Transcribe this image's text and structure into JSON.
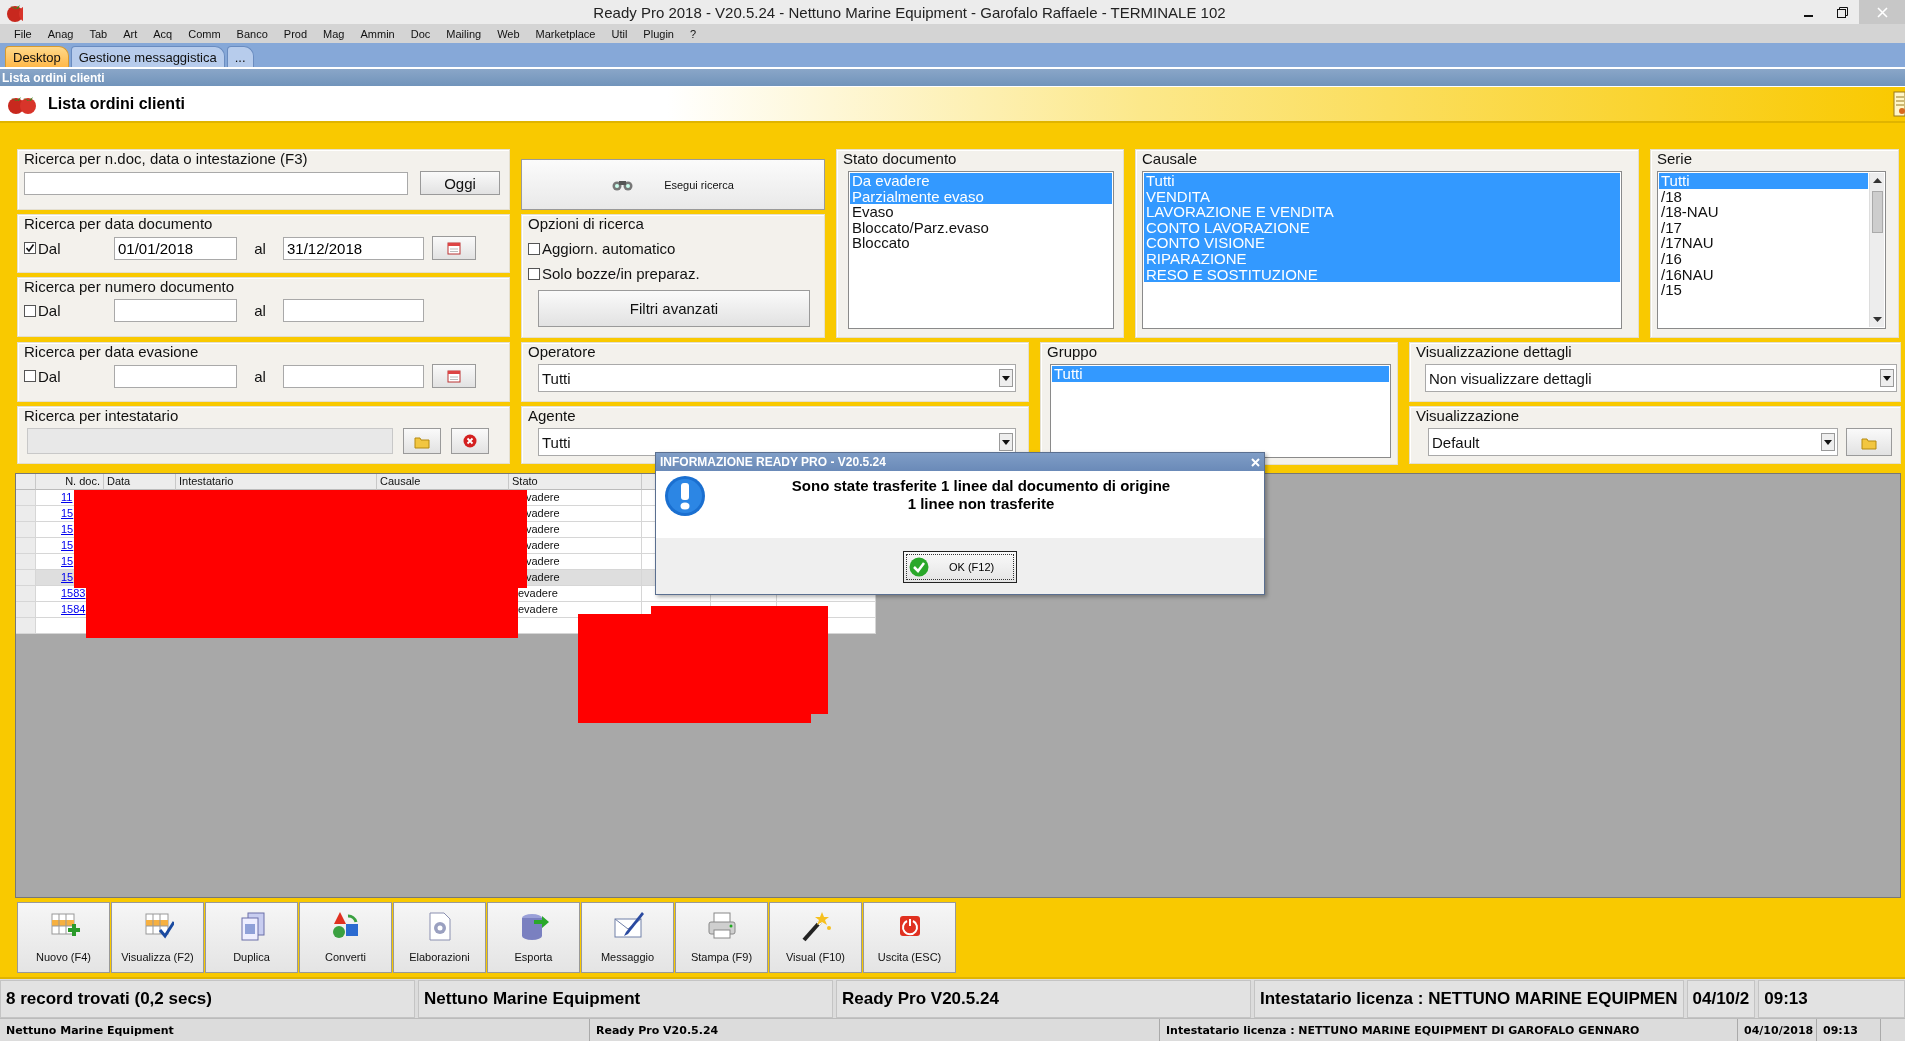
{
  "window": {
    "title": "Ready Pro 2018 - V20.5.24 - Nettuno Marine Equipment - Garofalo Raffaele - TERMINALE 102"
  },
  "menu": [
    "File",
    "Anag",
    "Tab",
    "Art",
    "Acq",
    "Comm",
    "Banco",
    "Prod",
    "Mag",
    "Ammin",
    "Doc",
    "Mailing",
    "Web",
    "Marketplace",
    "Util",
    "Plugin",
    "?"
  ],
  "tabs": [
    {
      "label": "Desktop",
      "selected": true
    },
    {
      "label": "Gestione messaggistica",
      "selected": false
    },
    {
      "label": "...",
      "selected": false
    }
  ],
  "caption": "Lista ordini clienti",
  "header": {
    "title": "Lista ordini clienti"
  },
  "filters": {
    "search": {
      "label": "Ricerca per n.doc, data o intestazione (F3)",
      "button": "Oggi"
    },
    "doc_date": {
      "label": "Ricerca per data documento",
      "check_label": "Dal",
      "checked": true,
      "from": "01/01/2018",
      "to_label": "al",
      "to": "31/12/2018"
    },
    "doc_number": {
      "label": "Ricerca per numero documento",
      "check_label": "Dal",
      "checked": false,
      "to_label": "al"
    },
    "due_date": {
      "label": "Ricerca per data evasione",
      "check_label": "Dal",
      "checked": false,
      "to_label": "al"
    },
    "holder": {
      "label": "Ricerca per intestatario",
      "disabled": true
    },
    "search_button": "Esegui ricerca",
    "options": {
      "label": "Opzioni di ricerca",
      "items": [
        {
          "label": "Aggiorn. automatico",
          "checked": false
        },
        {
          "label": "Solo bozze/in preparaz.",
          "checked": false
        }
      ],
      "button": "Filtri avanzati"
    },
    "stato": {
      "label": "Stato documento",
      "items": [
        {
          "label": "Da evadere",
          "selected": true
        },
        {
          "label": "Parzialmente evaso",
          "selected": true
        },
        {
          "label": "Evaso",
          "selected": false
        },
        {
          "label": "Bloccato/Parz.evaso",
          "selected": false
        },
        {
          "label": "Bloccato",
          "selected": false
        }
      ]
    },
    "causale": {
      "label": "Causale",
      "items": [
        {
          "label": "Tutti",
          "selected": true
        },
        {
          "label": "VENDITA",
          "selected": true
        },
        {
          "label": "LAVORAZIONE E VENDITA",
          "selected": true
        },
        {
          "label": "CONTO LAVORAZIONE",
          "selected": true
        },
        {
          "label": "CONTO VISIONE",
          "selected": true
        },
        {
          "label": "RIPARAZIONE",
          "selected": true
        },
        {
          "label": "RESO E SOSTITUZIONE",
          "selected": true
        }
      ]
    },
    "serie": {
      "label": "Serie",
      "items": [
        {
          "label": "Tutti",
          "selected": true
        },
        {
          "label": "/18",
          "selected": false
        },
        {
          "label": "/18-NAU",
          "selected": false
        },
        {
          "label": "/17",
          "selected": false
        },
        {
          "label": "/17NAU",
          "selected": false
        },
        {
          "label": "/16",
          "selected": false
        },
        {
          "label": "/16NAU",
          "selected": false
        },
        {
          "label": "/15",
          "selected": false
        }
      ]
    },
    "operatore": {
      "label": "Operatore",
      "value": "Tutti"
    },
    "agente": {
      "label": "Agente",
      "value": "Tutti"
    },
    "gruppo": {
      "label": "Gruppo",
      "items": [
        {
          "label": "Tutti",
          "selected": true
        }
      ]
    },
    "dettagli": {
      "label": "Visualizzazione dettagli",
      "value": "Non visualizzare dettagli"
    },
    "visualizzazione": {
      "label": "Visualizzazione",
      "value": "Default"
    }
  },
  "grid": {
    "columns": [
      "N. doc.",
      "Data",
      "Intestatario",
      "Causale",
      "Stato"
    ],
    "rows": [
      {
        "doc": "11",
        "stato": "vadere",
        "selected": false
      },
      {
        "doc": "15",
        "stato": "vadere",
        "selected": false
      },
      {
        "doc": "15",
        "stato": "vadere",
        "selected": false
      },
      {
        "doc": "15",
        "stato": "vadere",
        "selected": false
      },
      {
        "doc": "15",
        "stato": "vadere",
        "selected": false
      },
      {
        "doc": "15",
        "stato": "vadere",
        "selected": true
      },
      {
        "doc": "1583",
        "stato": "evadere",
        "selected": false
      },
      {
        "doc": "1584",
        "stato": "evadere",
        "selected": false
      }
    ]
  },
  "dialog": {
    "title": "INFORMAZIONE READY PRO - V20.5.24",
    "message": [
      "Sono state trasferite 1 linee dal documento di origine",
      "1 linee non trasferite"
    ],
    "button": "OK (F12)"
  },
  "toolbar": [
    {
      "label": "Nuovo (F4)",
      "kind": "new"
    },
    {
      "label": "Visualizza (F2)",
      "kind": "view"
    },
    {
      "label": "Duplica",
      "kind": "copy"
    },
    {
      "label": "Converti",
      "kind": "convert"
    },
    {
      "label": "Elaborazioni",
      "kind": "process"
    },
    {
      "label": "Esporta",
      "kind": "export"
    },
    {
      "label": "Messaggio",
      "kind": "message"
    },
    {
      "label": "Stampa (F9)",
      "kind": "print"
    },
    {
      "label": "Visual (F10)",
      "kind": "wand"
    },
    {
      "label": "Uscita (ESC)",
      "kind": "exit"
    }
  ],
  "status_bar": [
    "8 record trovati (0,2 secs)",
    "Nettuno Marine Equipment",
    "Ready Pro V20.5.24",
    "Intestatario licenza : NETTUNO MARINE EQUIPMEN",
    "04/10/2",
    "09:13"
  ],
  "status_bar_2": [
    "Nettuno Marine Equipment",
    "Ready Pro V20.5.24",
    "Intestatario licenza : NETTUNO MARINE EQUIPMENT DI GAROFALO GENNARO",
    "04/10/2018",
    "09:13"
  ]
}
